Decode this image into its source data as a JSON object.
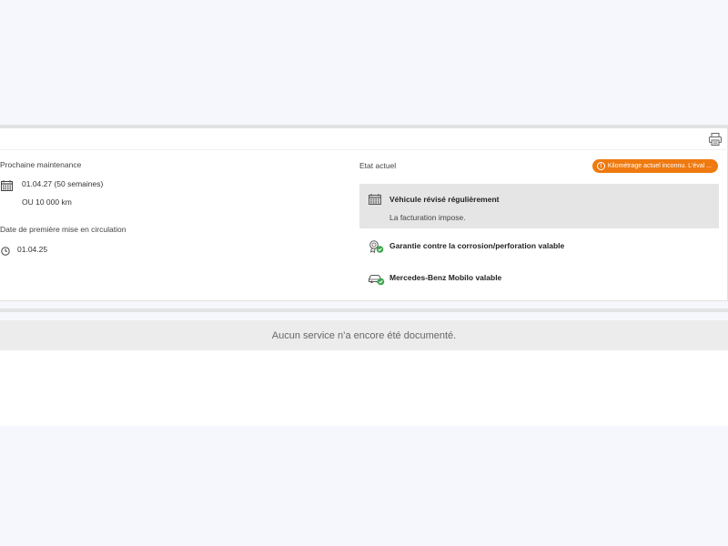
{
  "toolbar": {
    "print_icon": "printer-icon"
  },
  "maintenance": {
    "label": "Prochaine maintenance",
    "date_value": "01.04.27 (50 semaines)",
    "km_value": "OU 10 000 km"
  },
  "registration": {
    "label": "Date de première mise en circulation",
    "date_value": "01.04.25"
  },
  "current_state": {
    "label": "Etat actuel",
    "badge_text": "Kilométrage actuel inconnu. L'éval ...",
    "badge_color": "#ef7a10",
    "items": [
      {
        "title": "Véhicule révisé régulièrement",
        "subtitle": "La facturation impose.",
        "icon": "calendar-icon"
      },
      {
        "title": "Garantie contre la corrosion/perforation valable",
        "icon": "warranty-check-icon"
      },
      {
        "title": "Mercedes-Benz Mobilo valable",
        "icon": "car-check-icon"
      }
    ]
  },
  "services": {
    "empty_text": "Aucun service n’a encore été documenté."
  },
  "colors": {
    "accent": "#ef7a10",
    "check": "#3aa64a",
    "background": "#f6f7fc"
  }
}
